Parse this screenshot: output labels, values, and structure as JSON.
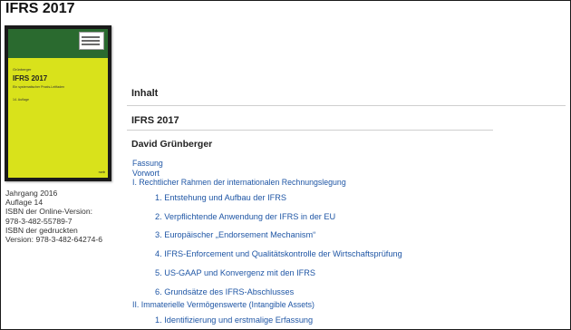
{
  "page": {
    "title": "IFRS 2017"
  },
  "cover": {
    "author": "Grünberger",
    "title": "IFRS 2017",
    "subtitle": "Ein systematischer Praxis-Leitfaden",
    "edition": "14. Auflage",
    "publisher": "nwb"
  },
  "meta": {
    "lines": [
      "Jahrgang 2016",
      "Auflage 14",
      "ISBN der Online-Version:",
      "978-3-482-55789-7",
      "ISBN der gedruckten",
      "Version: 978-3-482-64274-6"
    ]
  },
  "content": {
    "heading_inhalt": "Inhalt",
    "heading_book": "IFRS 2017",
    "author": "David Grünberger",
    "toc": [
      "Fassung",
      "Vorwort",
      "I. Rechtlicher Rahmen der internationalen Rechnungslegung",
      "1. Entstehung und Aufbau der IFRS",
      "2. Verpflichtende Anwendung der IFRS in der EU",
      "3. Europäischer „Endorsement Mechanism“",
      "4. IFRS-Enforcement und Qualitätskontrolle der Wirtschaftsprüfung",
      "5. US-GAAP und Konvergenz mit den IFRS",
      "6. Grundsätze des IFRS-Abschlusses",
      "II. Immaterielle Vermögenswerte (Intangible Assets)",
      "1. Identifizierung und erstmalige Erfassung"
    ]
  },
  "colors": {
    "link": "#1f56a5",
    "cover_green": "#2a6a2f",
    "cover_yellow": "#d9e21b"
  }
}
